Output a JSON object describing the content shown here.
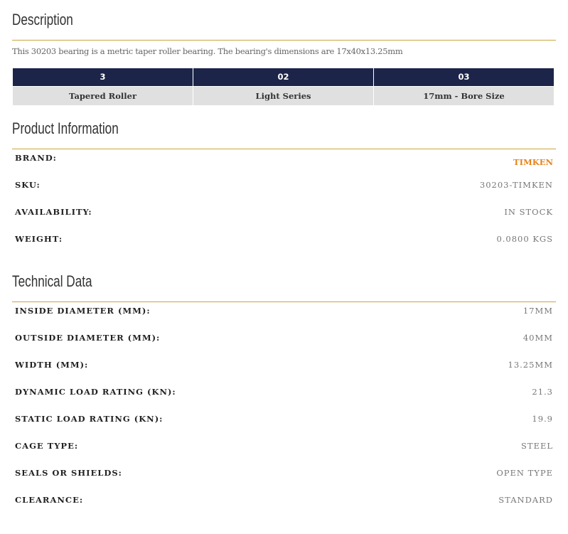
{
  "description": {
    "title": "Description",
    "text": "This 30203 bearing is a metric taper roller bearing. The bearing's dimensions are 17x40x13.25mm",
    "code_table": {
      "headers": [
        "3",
        "02",
        "03"
      ],
      "values": [
        "Tapered Roller",
        "Light Series",
        "17mm - Bore Size"
      ]
    }
  },
  "product_info": {
    "title": "Product Information",
    "rows": [
      {
        "label": "BRAND:",
        "value": "TIMKEN"
      },
      {
        "label": "SKU:",
        "value": "30203-TIMKEN"
      },
      {
        "label": "AVAILABILITY:",
        "value": "IN STOCK"
      },
      {
        "label": "WEIGHT:",
        "value": "0.0800 KGS"
      }
    ],
    "brand_color": "#e8841c"
  },
  "technical_data": {
    "title": "Technical Data",
    "rows": [
      {
        "label": "INSIDE DIAMETER (MM):",
        "value": "17MM"
      },
      {
        "label": "OUTSIDE DIAMETER (MM):",
        "value": "40MM"
      },
      {
        "label": "WIDTH (MM):",
        "value": "13.25MM"
      },
      {
        "label": "DYNAMIC LOAD RATING (KN):",
        "value": "21.3"
      },
      {
        "label": "STATIC LOAD RATING (KN):",
        "value": "19.9"
      },
      {
        "label": "CAGE TYPE:",
        "value": "STEEL"
      },
      {
        "label": "SEALS OR SHIELDS:",
        "value": "OPEN TYPE"
      },
      {
        "label": "CLEARANCE:",
        "value": "STANDARD"
      }
    ]
  }
}
